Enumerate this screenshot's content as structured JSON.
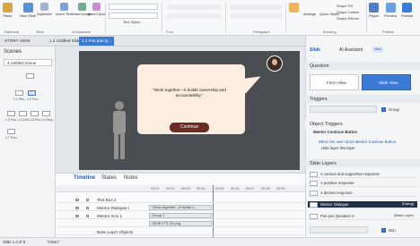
{
  "ribbon": {
    "groups": [
      "Clipboard",
      "Slide",
      "AI Assistant",
      "Font",
      "Paragraph",
      "Drawing",
      "Publish"
    ],
    "buttons": {
      "paste": "Paste",
      "new_slide": "New Slide",
      "duplicate": "Duplicate",
      "insert_text": "Insert Text",
      "insert_image": "Insert Image",
      "insert_quiz": "Insert Quiz",
      "text_styles": "Text Styles",
      "arrange": "Arrange",
      "quick_styles": "Quick Styles",
      "shape_fill": "Shape Fill",
      "shape_outline": "Shape Outline",
      "shape_effects": "Shape Effects",
      "player": "Player",
      "preview": "Preview",
      "publish": "Publish"
    }
  },
  "doc_tabs": [
    {
      "label": "STORY VIEW"
    },
    {
      "label": "1.4 Untitled Slide"
    },
    {
      "label": "1.2 Pos pos Q..."
    }
  ],
  "scenes": {
    "title": "Scenes",
    "selector": "4 Untitled Scene",
    "thumbs": [
      "1.1 Res...",
      "1.2 Pos...",
      "1.3 Pos...",
      "1.4 Unti...",
      "1.5 Pos...",
      "1.6 Neg...",
      "1.7 Pos..."
    ]
  },
  "stage": {
    "bubble_text": "\"Work together—it builds ownership and accountability.\"",
    "continue_label": "Continue"
  },
  "timeline": {
    "tabs": [
      "Timeline",
      "States",
      "Notes"
    ],
    "ticks": [
      "00:01",
      "00:02",
      "00:03",
      "00:04",
      "00:05",
      "00:06",
      "00:07",
      "00:08",
      "00:09"
    ],
    "rows": [
      {
        "label": "Text Box 2",
        "bar": ""
      },
      {
        "label": "Mentor Dialogue I",
        "bar": "\"Work together—it builds o..."
      },
      {
        "label": "Mentor Icon 1",
        "bar": "Group 1"
      },
      {
        "label": "",
        "bar": "OBJECTS-15.png"
      },
      {
        "label": "Base Layer Objects",
        "bar": ""
      }
    ]
  },
  "right_panel": {
    "tabs": {
      "properties": "Slide",
      "ai": "AI Assistant",
      "new_badge": "New"
    },
    "question_header": "Question",
    "form_view": "Form View",
    "slide_view": "Slide View",
    "triggers_header": "Triggers",
    "group_label": "Group",
    "object_triggers": "Object Triggers",
    "trigger_object": "Mentor Continue Button",
    "trigger_when": "When the user clicks Mentor Continue Button",
    "trigger_action": "Hide layer this layer",
    "slide_layers_header": "Slide Layers",
    "layers": [
      {
        "label": "A curious and supportive response",
        "note": ""
      },
      {
        "label": "A punitive response",
        "note": ""
      },
      {
        "label": "A decent response",
        "note": ""
      },
      {
        "label": "Mentor Dialogue",
        "note": "(Dialog)"
      },
      {
        "label": "Pos pos Question 2",
        "note": "(Base Layer)"
      }
    ],
    "dim_label": "Dim"
  },
  "status": {
    "left": "Slide 1.4 of 8",
    "middle": "\"Clean\""
  }
}
